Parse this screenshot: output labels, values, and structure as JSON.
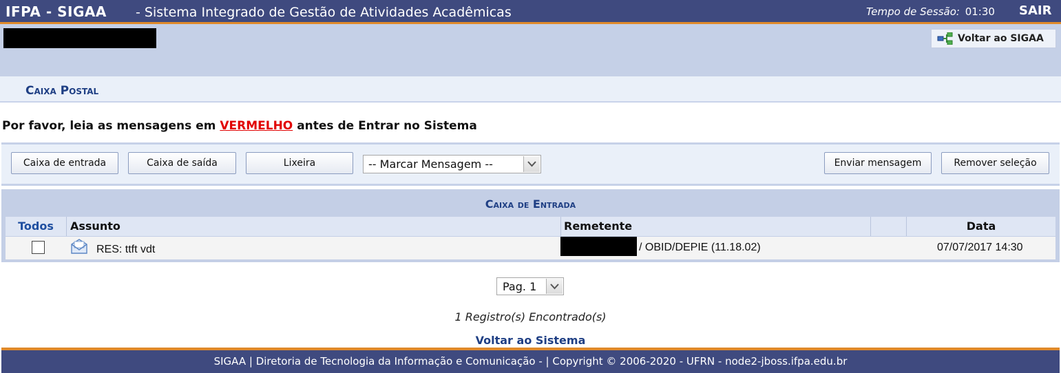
{
  "header": {
    "brand": "IFPA - SIGAA",
    "system_title": "- Sistema Integrado de Gestão de Atividades Acadêmicas",
    "session_label": "Tempo de Sessão:",
    "session_time": "01:30",
    "logout_label": "SAIR"
  },
  "userbar": {
    "back_to_sigaa_label": "Voltar ao SIGAA"
  },
  "page": {
    "title": "Caixa Postal",
    "warning_prefix": "Por favor, leia as mensagens em",
    "warning_highlight": "VERMELHO",
    "warning_suffix": "antes de Entrar no Sistema"
  },
  "toolbar": {
    "inbox_label": "Caixa de entrada",
    "outbox_label": "Caixa de saída",
    "trash_label": "Lixeira",
    "mark_select_value": "-- Marcar Mensagem --",
    "send_label": "Enviar mensagem",
    "remove_label": "Remover seleção"
  },
  "inbox": {
    "title": "Caixa de Entrada",
    "columns": {
      "all": "Todos",
      "subject": "Assunto",
      "sender": "Remetente",
      "date": "Data"
    },
    "rows": [
      {
        "subject": "RES: ttft vdt",
        "sender_unit": "/ OBID/DEPIE (11.18.02)",
        "date": "07/07/2017 14:30",
        "icon": "envelope-icon"
      }
    ]
  },
  "pagination": {
    "page_select_value": "Pag. 1",
    "records_found": "1 Registro(s) Encontrado(s)",
    "back_link": "Voltar ao Sistema"
  },
  "footer": {
    "text": "SIGAA | Diretoria de Tecnologia da Informação e Comunicação - | Copyright © 2006-2020 - UFRN - node2-jboss.ifpa.edu.br"
  },
  "colors": {
    "header_bg": "#3f4a7f",
    "accent_orange": "#e08a2a",
    "user_area_bg": "#c5d0e7",
    "title_blue": "#1f3f84",
    "warning_red": "#e10000"
  }
}
